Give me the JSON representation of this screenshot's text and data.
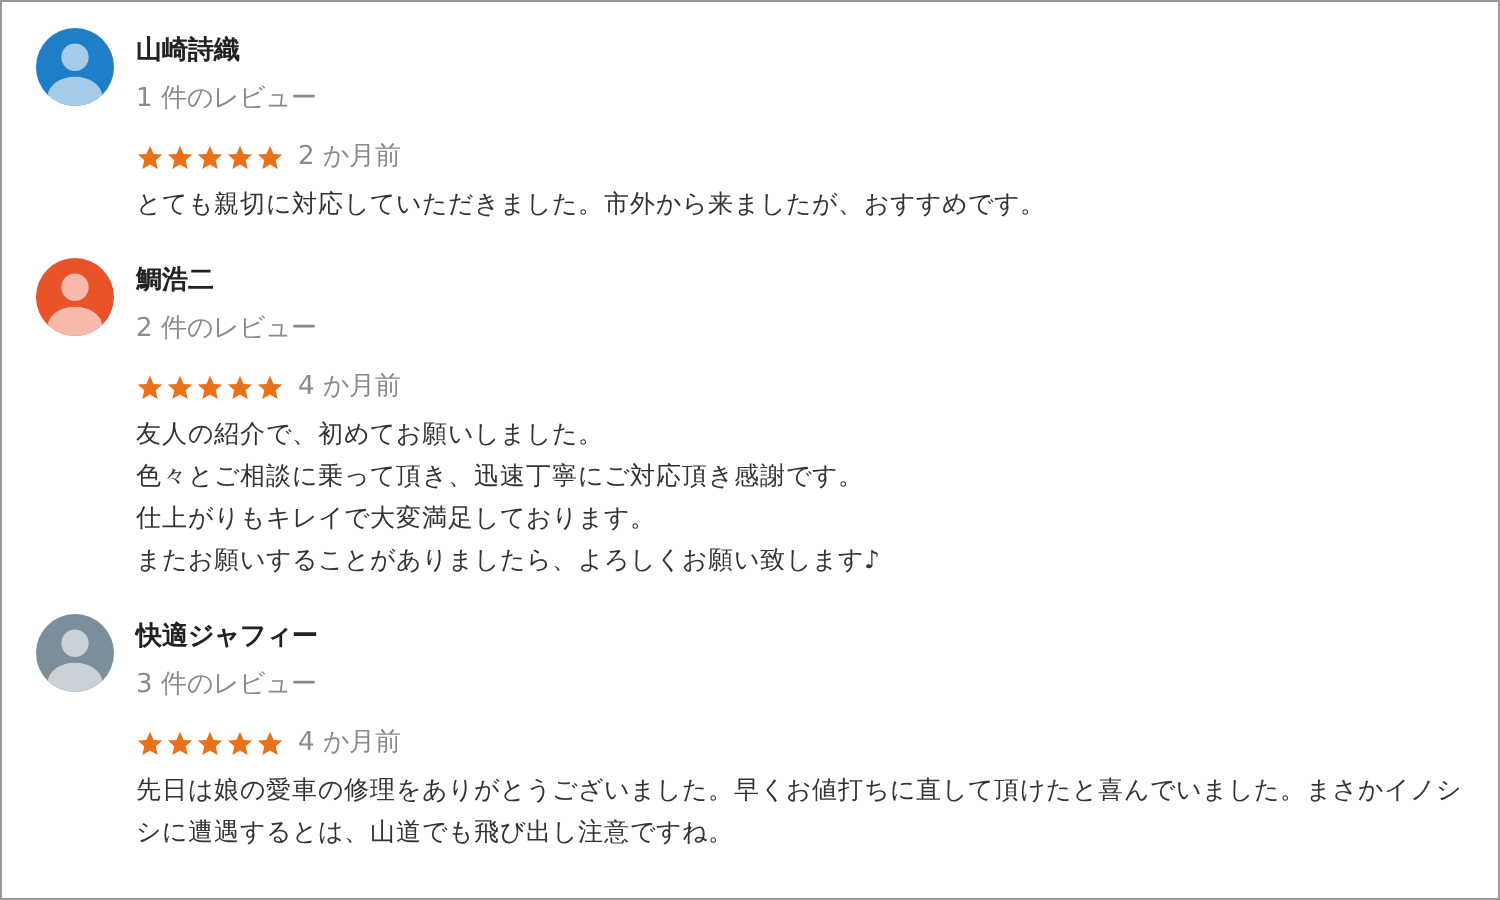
{
  "reviews": [
    {
      "name": "山崎詩織",
      "color": "#1e7fc8",
      "review_count": "1 件のレビュー",
      "stars": 5,
      "time": "2 か月前",
      "body": [
        "とても親切に対応していただきました。市外から来ましたが、おすすめです。"
      ]
    },
    {
      "name": "鯛浩二",
      "color": "#e8532a",
      "review_count": "2 件のレビュー",
      "stars": 5,
      "time": "4 か月前",
      "body": [
        "友人の紹介で、初めてお願いしました。",
        "色々とご相談に乗って頂き、迅速丁寧にご対応頂き感謝です。",
        "仕上がりもキレイで大変満足しております。",
        "またお願いすることがありましたら、よろしくお願い致します♪"
      ]
    },
    {
      "name": "快適ジャフィー",
      "color": "#7b8e9b",
      "review_count": "3 件のレビュー",
      "stars": 5,
      "time": "4 か月前",
      "body": [
        "先日は娘の愛車の修理をありがとうございました。早くお値打ちに直して頂けたと喜んでいました。まさかイノシシに遭遇するとは、山道でも飛び出し注意ですね。"
      ]
    }
  ]
}
